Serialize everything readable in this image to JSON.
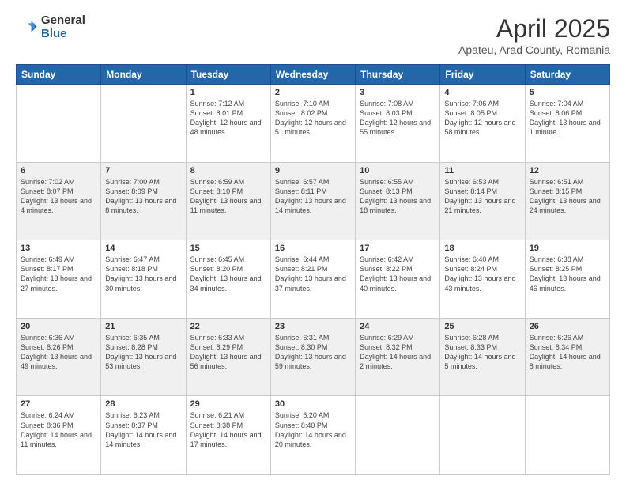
{
  "logo": {
    "general": "General",
    "blue": "Blue"
  },
  "title": "April 2025",
  "location": "Apateu, Arad County, Romania",
  "days_header": [
    "Sunday",
    "Monday",
    "Tuesday",
    "Wednesday",
    "Thursday",
    "Friday",
    "Saturday"
  ],
  "weeks": [
    [
      {
        "day": "",
        "info": ""
      },
      {
        "day": "",
        "info": ""
      },
      {
        "day": "1",
        "info": "Sunrise: 7:12 AM\nSunset: 8:01 PM\nDaylight: 12 hours and 48 minutes."
      },
      {
        "day": "2",
        "info": "Sunrise: 7:10 AM\nSunset: 8:02 PM\nDaylight: 12 hours and 51 minutes."
      },
      {
        "day": "3",
        "info": "Sunrise: 7:08 AM\nSunset: 8:03 PM\nDaylight: 12 hours and 55 minutes."
      },
      {
        "day": "4",
        "info": "Sunrise: 7:06 AM\nSunset: 8:05 PM\nDaylight: 12 hours and 58 minutes."
      },
      {
        "day": "5",
        "info": "Sunrise: 7:04 AM\nSunset: 8:06 PM\nDaylight: 13 hours and 1 minute."
      }
    ],
    [
      {
        "day": "6",
        "info": "Sunrise: 7:02 AM\nSunset: 8:07 PM\nDaylight: 13 hours and 4 minutes."
      },
      {
        "day": "7",
        "info": "Sunrise: 7:00 AM\nSunset: 8:09 PM\nDaylight: 13 hours and 8 minutes."
      },
      {
        "day": "8",
        "info": "Sunrise: 6:59 AM\nSunset: 8:10 PM\nDaylight: 13 hours and 11 minutes."
      },
      {
        "day": "9",
        "info": "Sunrise: 6:57 AM\nSunset: 8:11 PM\nDaylight: 13 hours and 14 minutes."
      },
      {
        "day": "10",
        "info": "Sunrise: 6:55 AM\nSunset: 8:13 PM\nDaylight: 13 hours and 18 minutes."
      },
      {
        "day": "11",
        "info": "Sunrise: 6:53 AM\nSunset: 8:14 PM\nDaylight: 13 hours and 21 minutes."
      },
      {
        "day": "12",
        "info": "Sunrise: 6:51 AM\nSunset: 8:15 PM\nDaylight: 13 hours and 24 minutes."
      }
    ],
    [
      {
        "day": "13",
        "info": "Sunrise: 6:49 AM\nSunset: 8:17 PM\nDaylight: 13 hours and 27 minutes."
      },
      {
        "day": "14",
        "info": "Sunrise: 6:47 AM\nSunset: 8:18 PM\nDaylight: 13 hours and 30 minutes."
      },
      {
        "day": "15",
        "info": "Sunrise: 6:45 AM\nSunset: 8:20 PM\nDaylight: 13 hours and 34 minutes."
      },
      {
        "day": "16",
        "info": "Sunrise: 6:44 AM\nSunset: 8:21 PM\nDaylight: 13 hours and 37 minutes."
      },
      {
        "day": "17",
        "info": "Sunrise: 6:42 AM\nSunset: 8:22 PM\nDaylight: 13 hours and 40 minutes."
      },
      {
        "day": "18",
        "info": "Sunrise: 6:40 AM\nSunset: 8:24 PM\nDaylight: 13 hours and 43 minutes."
      },
      {
        "day": "19",
        "info": "Sunrise: 6:38 AM\nSunset: 8:25 PM\nDaylight: 13 hours and 46 minutes."
      }
    ],
    [
      {
        "day": "20",
        "info": "Sunrise: 6:36 AM\nSunset: 8:26 PM\nDaylight: 13 hours and 49 minutes."
      },
      {
        "day": "21",
        "info": "Sunrise: 6:35 AM\nSunset: 8:28 PM\nDaylight: 13 hours and 53 minutes."
      },
      {
        "day": "22",
        "info": "Sunrise: 6:33 AM\nSunset: 8:29 PM\nDaylight: 13 hours and 56 minutes."
      },
      {
        "day": "23",
        "info": "Sunrise: 6:31 AM\nSunset: 8:30 PM\nDaylight: 13 hours and 59 minutes."
      },
      {
        "day": "24",
        "info": "Sunrise: 6:29 AM\nSunset: 8:32 PM\nDaylight: 14 hours and 2 minutes."
      },
      {
        "day": "25",
        "info": "Sunrise: 6:28 AM\nSunset: 8:33 PM\nDaylight: 14 hours and 5 minutes."
      },
      {
        "day": "26",
        "info": "Sunrise: 6:26 AM\nSunset: 8:34 PM\nDaylight: 14 hours and 8 minutes."
      }
    ],
    [
      {
        "day": "27",
        "info": "Sunrise: 6:24 AM\nSunset: 8:36 PM\nDaylight: 14 hours and 11 minutes."
      },
      {
        "day": "28",
        "info": "Sunrise: 6:23 AM\nSunset: 8:37 PM\nDaylight: 14 hours and 14 minutes."
      },
      {
        "day": "29",
        "info": "Sunrise: 6:21 AM\nSunset: 8:38 PM\nDaylight: 14 hours and 17 minutes."
      },
      {
        "day": "30",
        "info": "Sunrise: 6:20 AM\nSunset: 8:40 PM\nDaylight: 14 hours and 20 minutes."
      },
      {
        "day": "",
        "info": ""
      },
      {
        "day": "",
        "info": ""
      },
      {
        "day": "",
        "info": ""
      }
    ]
  ]
}
